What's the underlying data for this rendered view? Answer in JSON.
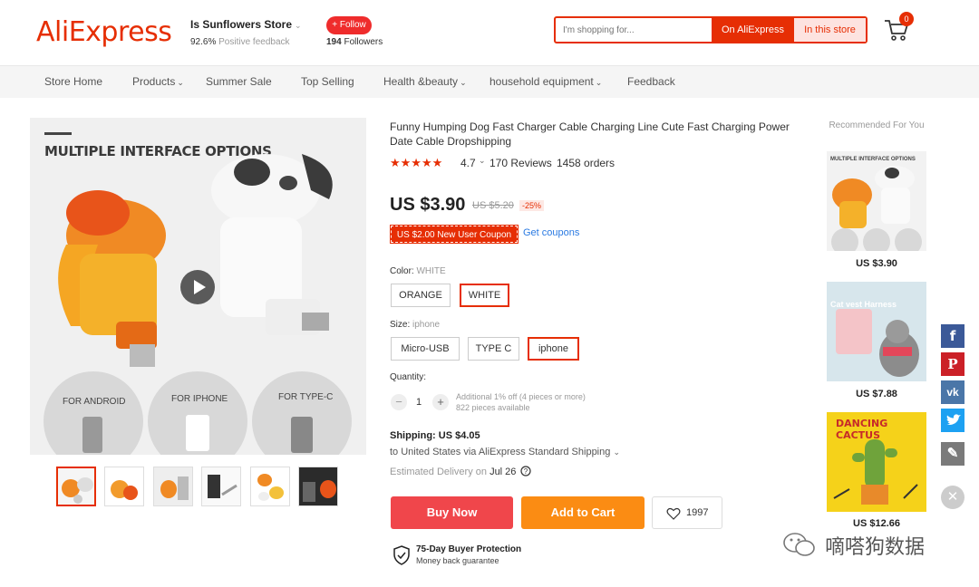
{
  "header": {
    "logo": "AliExpress",
    "store_name": "Is Sunflowers Store",
    "feedback_percent": "92.6%",
    "feedback_label": "Positive feedback",
    "follow_label": "+ Follow",
    "followers_count": "194",
    "followers_label": "Followers",
    "search_placeholder": "I'm shopping for...",
    "search_on_aliexpress": "On AliExpress",
    "search_in_store": "In this store",
    "cart_count": "0"
  },
  "nav": {
    "items": [
      {
        "label": "Store Home",
        "dropdown": false
      },
      {
        "label": "Products",
        "dropdown": true
      },
      {
        "label": "Summer Sale",
        "dropdown": false
      },
      {
        "label": "Top Selling",
        "dropdown": false
      },
      {
        "label": "Health &beauty",
        "dropdown": true
      },
      {
        "label": "household equipment",
        "dropdown": true
      },
      {
        "label": "Feedback",
        "dropdown": false
      }
    ]
  },
  "gallery": {
    "headline": "MULTIPLE INTERFACE OPTIONS",
    "port_labels": [
      "FOR ANDROID",
      "FOR IPHONE",
      "FOR TYPE-C"
    ],
    "thumbnail_count": 6,
    "active_thumbnail": 1
  },
  "product": {
    "title": "Funny Humping Dog Fast Charger Cable Charging Line Cute Fast Charging Power Date Cable Dropshipping",
    "rating": "4.7",
    "reviews": "170 Reviews",
    "orders": "1458 orders",
    "price": "US $3.90",
    "original_price": "US $5.20",
    "discount": "-25%",
    "coupon": "US $2.00 New User Coupon",
    "get_coupons": "Get coupons",
    "color_label": "Color:",
    "color_selected": "WHITE",
    "colors": [
      "ORANGE",
      "WHITE"
    ],
    "size_label": "Size:",
    "size_selected": "iphone",
    "sizes": [
      "Micro-USB",
      "TYPE C",
      "iphone"
    ],
    "quantity_label": "Quantity:",
    "quantity": "1",
    "qty_minus": "−",
    "qty_plus": "+",
    "qty_discount_note": "Additional 1% off (4 pieces or more)",
    "qty_available": "822 pieces available",
    "shipping": "Shipping: US $4.05",
    "ship_to": "to United States via AliExpress Standard Shipping",
    "delivery_label": "Estimated Delivery on",
    "delivery_date": "Jul 26",
    "buy_now": "Buy Now",
    "add_to_cart": "Add to Cart",
    "wishlist_count": "1997",
    "protection_title": "75-Day Buyer Protection",
    "protection_sub": "Money back guarantee"
  },
  "recommended": {
    "title": "Recommended For You",
    "items": [
      {
        "price": "US $3.90",
        "image_text": "MULTIPLE INTERFACE OPTIONS"
      },
      {
        "price": "US $7.88",
        "image_text": "Cat vest Harness"
      },
      {
        "price": "US $12.66",
        "image_text": "DANCING CACTUS"
      }
    ]
  },
  "social": {
    "facebook": "f",
    "pinterest": "P",
    "vk": "vk",
    "edit": "✎",
    "close": "✕"
  },
  "watermark": "嘀嗒狗数据",
  "colors": {
    "brand_red": "#e62e04",
    "buy_now": "#f0464b",
    "add_to_cart": "#fb8c13",
    "link_blue": "#2a7ae2"
  }
}
